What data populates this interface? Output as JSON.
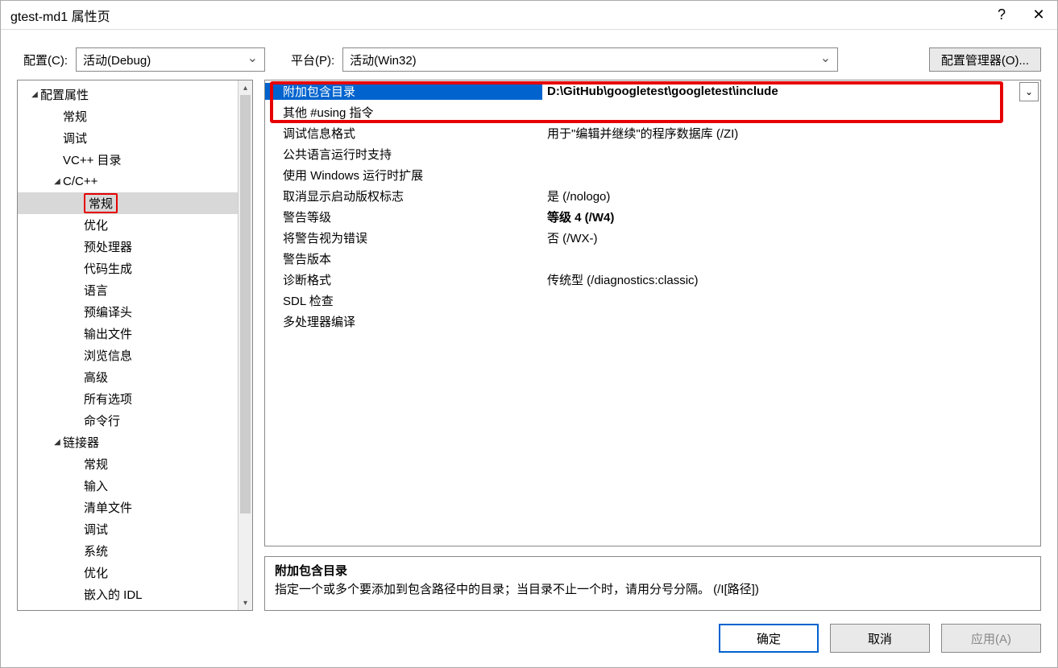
{
  "titlebar": {
    "title": "gtest-md1 属性页",
    "help": "?",
    "close": "✕"
  },
  "config": {
    "config_label": "配置(C):",
    "config_value": "活动(Debug)",
    "platform_label": "平台(P):",
    "platform_value": "活动(Win32)",
    "manager_btn": "配置管理器(O)..."
  },
  "tree": [
    {
      "label": "配置属性",
      "level": 0,
      "expand": true
    },
    {
      "label": "常规",
      "level": 1
    },
    {
      "label": "调试",
      "level": 1
    },
    {
      "label": "VC++ 目录",
      "level": 1
    },
    {
      "label": "C/C++",
      "level": 1,
      "expand": true
    },
    {
      "label": "常规",
      "level": 2,
      "selected": true
    },
    {
      "label": "优化",
      "level": 2
    },
    {
      "label": "预处理器",
      "level": 2
    },
    {
      "label": "代码生成",
      "level": 2
    },
    {
      "label": "语言",
      "level": 2
    },
    {
      "label": "预编译头",
      "level": 2
    },
    {
      "label": "输出文件",
      "level": 2
    },
    {
      "label": "浏览信息",
      "level": 2
    },
    {
      "label": "高级",
      "level": 2
    },
    {
      "label": "所有选项",
      "level": 2
    },
    {
      "label": "命令行",
      "level": 2
    },
    {
      "label": "链接器",
      "level": 1,
      "expand": true
    },
    {
      "label": "常规",
      "level": 2
    },
    {
      "label": "输入",
      "level": 2
    },
    {
      "label": "清单文件",
      "level": 2
    },
    {
      "label": "调试",
      "level": 2
    },
    {
      "label": "系统",
      "level": 2
    },
    {
      "label": "优化",
      "level": 2
    },
    {
      "label": "嵌入的 IDL",
      "level": 2
    }
  ],
  "props": [
    {
      "label": "附加包含目录",
      "value": "D:\\GitHub\\googletest\\googletest\\include",
      "selected": true,
      "bold": true
    },
    {
      "label": "其他 #using 指令",
      "value": ""
    },
    {
      "label": "调试信息格式",
      "value": "用于\"编辑并继续\"的程序数据库 (/ZI)"
    },
    {
      "label": "公共语言运行时支持",
      "value": ""
    },
    {
      "label": "使用 Windows 运行时扩展",
      "value": ""
    },
    {
      "label": "取消显示启动版权标志",
      "value": "是 (/nologo)"
    },
    {
      "label": "警告等级",
      "value": "等级 4 (/W4)",
      "bold": true
    },
    {
      "label": "将警告视为错误",
      "value": "否 (/WX-)"
    },
    {
      "label": "警告版本",
      "value": ""
    },
    {
      "label": "诊断格式",
      "value": "传统型 (/diagnostics:classic)"
    },
    {
      "label": "SDL 检查",
      "value": ""
    },
    {
      "label": "多处理器编译",
      "value": ""
    }
  ],
  "desc": {
    "title": "附加包含目录",
    "text": "指定一个或多个要添加到包含路径中的目录；当目录不止一个时，请用分号分隔。     (/I[路径])"
  },
  "buttons": {
    "ok": "确定",
    "cancel": "取消",
    "apply": "应用(A)"
  }
}
